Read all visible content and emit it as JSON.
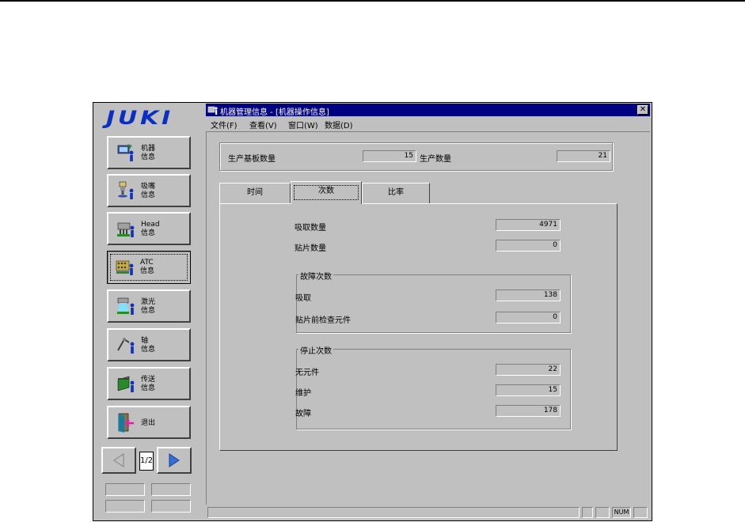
{
  "brand": {
    "logo": "JUKI"
  },
  "sidebar": {
    "buttons": [
      {
        "label": "机器\n信息",
        "icon": "machine-info-icon"
      },
      {
        "label": "吸嘴\n信息",
        "icon": "nozzle-info-icon"
      },
      {
        "label": "Head\n信息",
        "icon": "head-info-icon"
      },
      {
        "label": "ATC\n信息",
        "icon": "atc-info-icon"
      },
      {
        "label": "激光\n信息",
        "icon": "laser-info-icon"
      },
      {
        "label": "轴\n信息",
        "icon": "axis-info-icon"
      },
      {
        "label": "传送\n信息",
        "icon": "conveyor-info-icon"
      },
      {
        "label": "退出",
        "icon": "exit-door-icon"
      }
    ],
    "active_index": 3,
    "pager": {
      "page": "1/2"
    }
  },
  "window": {
    "title": "机器管理信息 - [机器操作信息]",
    "menu": [
      "文件(F)",
      "查看(V)",
      "窗口(W)",
      "数据(D)"
    ]
  },
  "summary": {
    "board_label": "生产基板数量",
    "board_value": "15",
    "prod_label": "生产数量",
    "prod_value": "21"
  },
  "tabs": {
    "items": [
      "时间",
      "次数",
      "比率"
    ],
    "selected": 1
  },
  "counts": {
    "pickup_label": "吸取数量",
    "pickup_value": "4971",
    "place_label": "贴片数量",
    "place_value": "0"
  },
  "fault_group": {
    "title": "故障次数",
    "rows": [
      {
        "label": "吸取",
        "value": "138"
      },
      {
        "label": "贴片前检查元件",
        "value": "0"
      }
    ]
  },
  "stop_group": {
    "title": "停止次数",
    "rows": [
      {
        "label": "无元件",
        "value": "22"
      },
      {
        "label": "维护",
        "value": "15"
      },
      {
        "label": "故障",
        "value": "178"
      }
    ]
  },
  "statusbar": {
    "num": "NUM"
  },
  "colors": {
    "logo": "#0a2fc2",
    "titlebar": "#000080",
    "face": "#c0c0c0"
  }
}
